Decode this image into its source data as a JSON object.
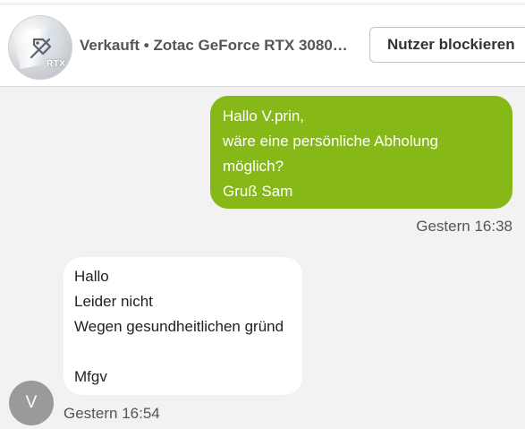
{
  "header": {
    "listing_title": "Verkauft • Zotac GeForce RTX 3080…",
    "thumbnail_text": "RTX",
    "block_button_label": "Nutzer blockieren"
  },
  "messages": [
    {
      "direction": "outgoing",
      "lines": [
        "Hallo V.prin,",
        "wäre eine persönliche Abholung",
        "möglich?",
        "Gruß Sam"
      ],
      "timestamp": "Gestern 16:38"
    },
    {
      "direction": "incoming",
      "lines": [
        "Hallo",
        "Leider nicht",
        "Wegen gesundheitlichen gründ",
        "",
        "Mfgv"
      ],
      "timestamp": "Gestern 16:54",
      "avatar_initial": "V"
    }
  ],
  "colors": {
    "outgoing_bubble": "#86b817",
    "incoming_bubble": "#ffffff",
    "background": "#f2f2f2",
    "avatar": "#9a9a9a"
  },
  "icons": {
    "thumbnail_overlay": "tag-off-icon"
  }
}
